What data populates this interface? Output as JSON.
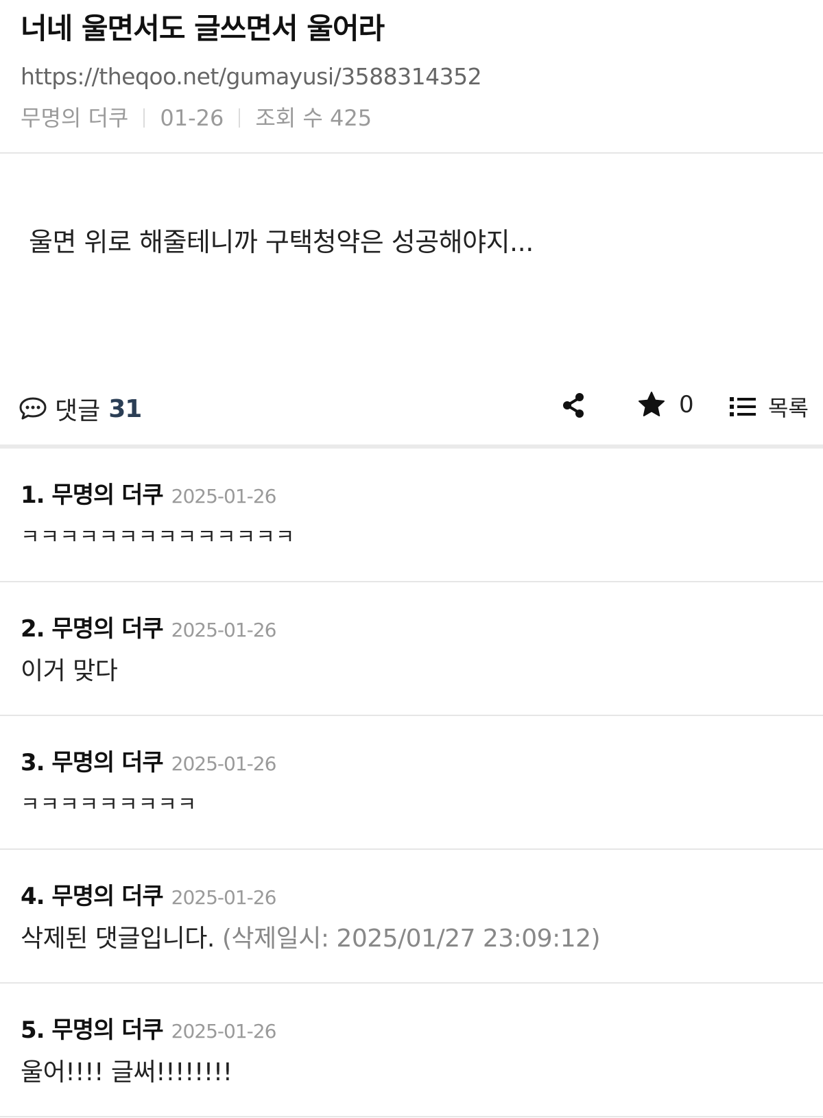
{
  "post": {
    "title": "너네 울면서도 글쓰면서 울어라",
    "url": "https://theqoo.net/gumayusi/3588314352",
    "author": "무명의 더쿠",
    "date": "01-26",
    "views": "조회 수 425",
    "body": "울면 위로 해줄테니까 구택청약은 성공해야지..."
  },
  "actions": {
    "comment_label": "댓글",
    "comment_count": "31",
    "star_count": "0",
    "list_label": "목록",
    "icons": [
      "comment-icon",
      "share-icon",
      "star-icon",
      "list-icon"
    ]
  },
  "comments": [
    {
      "author": "1. 무명의 더쿠",
      "date": "2025-01-26",
      "text": "ㅋㅋㅋㅋㅋㅋㅋㅋㅋㅋㅋㅋㅋㅋ"
    },
    {
      "author": "2. 무명의 더쿠",
      "date": "2025-01-26",
      "text": "이거 맞다"
    },
    {
      "author": "3. 무명의 더쿠",
      "date": "2025-01-26",
      "text": "ㅋㅋㅋㅋㅋㅋㅋㅋㅋ"
    },
    {
      "author": "4. 무명의 더쿠",
      "date": "2025-01-26",
      "text": "삭제된 댓글입니다.",
      "note": "(삭제일시: 2025/01/27 23:09:12)"
    },
    {
      "author": "5. 무명의 더쿠",
      "date": "2025-01-26",
      "text": "울어!!!! 글써!!!!!!!!"
    }
  ]
}
